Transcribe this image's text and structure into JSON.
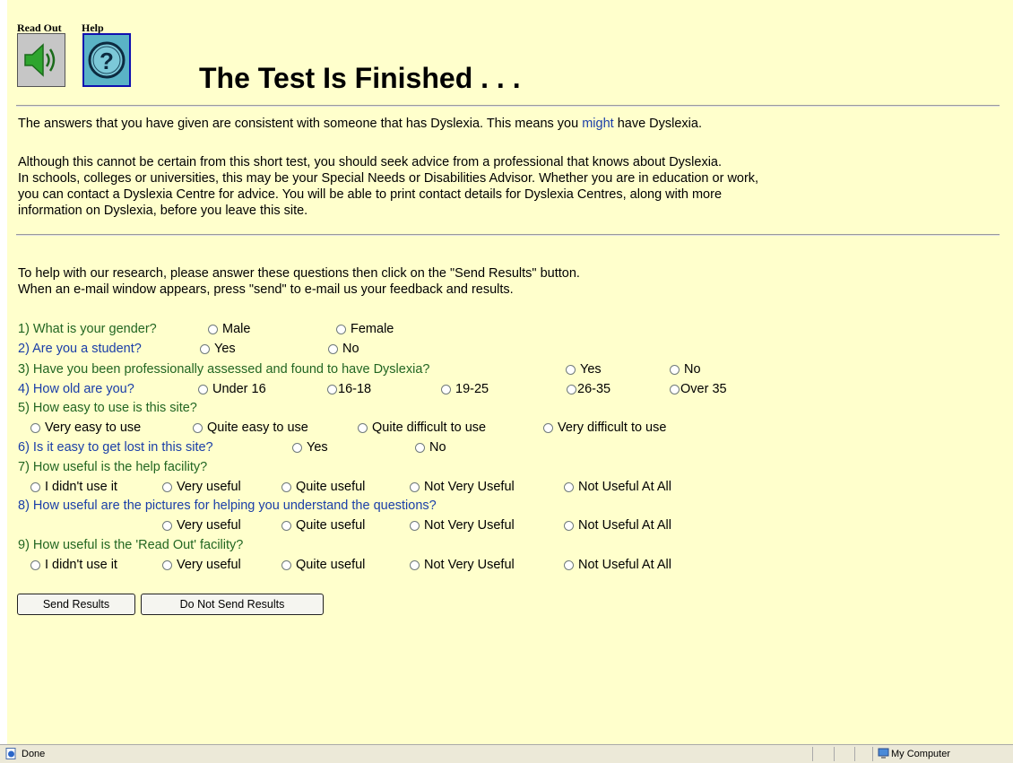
{
  "toolbar": {
    "read_out_label": "Read Out",
    "help_label": "Help"
  },
  "heading": "The Test Is Finished . . .",
  "result": {
    "line1_prefix": "The answers that you have given are consistent with someone that has Dyslexia.  This means you ",
    "line1_might": "might",
    "line1_suffix": " have Dyslexia.",
    "advice": [
      "Although this cannot be certain from this short test, you should seek advice from a professional that knows about Dyslexia.",
      "In schools, colleges or universities, this may be your Special Needs or Disabilities Advisor.  Whether you are in education or work,",
      "you can contact a Dyslexia Centre for advice.  You will be able to print contact details for Dyslexia Centres, along with more",
      "information on Dyslexia, before you leave this site."
    ]
  },
  "research": {
    "line1": "To help with our research, please answer these questions then click on the \"Send Results\" button.",
    "line2": "When an e-mail window appears, press \"send\" to e-mail us your feedback and results."
  },
  "questions": [
    {
      "text": "1) What is your gender?",
      "options": [
        "Male",
        "Female"
      ]
    },
    {
      "text": "2) Are you a student?",
      "options": [
        "Yes",
        "No"
      ]
    },
    {
      "text": "3) Have you been professionally assessed and found to have Dyslexia?",
      "options": [
        "Yes",
        "No"
      ]
    },
    {
      "text": "4) How old are you?",
      "options": [
        "Under 16",
        "16-18",
        "19-25",
        "26-35",
        "Over 35"
      ]
    },
    {
      "text": "5) How easy to use is this site?",
      "options": [
        "Very easy to use",
        "Quite easy to use",
        "Quite difficult to use",
        "Very difficult to use"
      ]
    },
    {
      "text": "6) Is it easy to get lost in this site?",
      "options": [
        "Yes",
        "No"
      ]
    },
    {
      "text": "7) How useful is the help facility?",
      "options": [
        "I didn't use it",
        "Very useful",
        "Quite useful",
        "Not Very Useful",
        "Not Useful At All"
      ]
    },
    {
      "text": "8) How useful are the pictures for helping you understand the questions?",
      "options": [
        "Very useful",
        "Quite useful",
        "Not Very Useful",
        "Not Useful At All"
      ]
    },
    {
      "text": "9) How useful is the 'Read Out' facility?",
      "options": [
        "I didn't use it",
        "Very useful",
        "Quite useful",
        "Not Very Useful",
        "Not Useful At All"
      ]
    }
  ],
  "buttons": {
    "send": "Send Results",
    "dont_send": "Do Not Send Results"
  },
  "status": {
    "text": "Done",
    "zone": "My Computer"
  },
  "colors": {
    "page_bg": "#ffffcc",
    "question_green": "#226622",
    "question_blue": "#1a3ea8"
  }
}
